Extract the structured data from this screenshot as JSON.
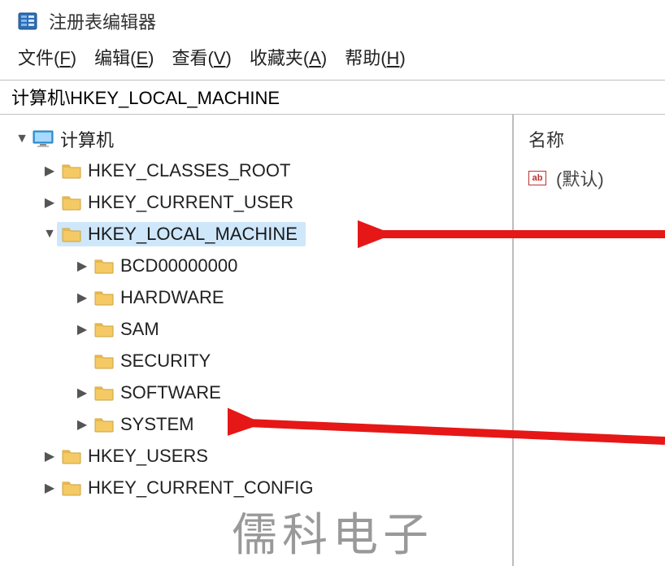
{
  "window_title": "注册表编辑器",
  "menu": {
    "file": {
      "label": "文件",
      "accel": "F"
    },
    "edit": {
      "label": "编辑",
      "accel": "E"
    },
    "view": {
      "label": "查看",
      "accel": "V"
    },
    "fav": {
      "label": "收藏夹",
      "accel": "A"
    },
    "help": {
      "label": "帮助",
      "accel": "H"
    }
  },
  "address": "计算机\\HKEY_LOCAL_MACHINE",
  "tree": {
    "root": {
      "label": "计算机",
      "expanded": true
    },
    "items": [
      {
        "label": "HKEY_CLASSES_ROOT",
        "depth": 1,
        "expanded": false,
        "hasChildren": true,
        "selected": false
      },
      {
        "label": "HKEY_CURRENT_USER",
        "depth": 1,
        "expanded": false,
        "hasChildren": true,
        "selected": false
      },
      {
        "label": "HKEY_LOCAL_MACHINE",
        "depth": 1,
        "expanded": true,
        "hasChildren": true,
        "selected": true
      },
      {
        "label": "BCD00000000",
        "depth": 2,
        "expanded": false,
        "hasChildren": true,
        "selected": false
      },
      {
        "label": "HARDWARE",
        "depth": 2,
        "expanded": false,
        "hasChildren": true,
        "selected": false
      },
      {
        "label": "SAM",
        "depth": 2,
        "expanded": false,
        "hasChildren": true,
        "selected": false
      },
      {
        "label": "SECURITY",
        "depth": 2,
        "expanded": false,
        "hasChildren": false,
        "selected": false
      },
      {
        "label": "SOFTWARE",
        "depth": 2,
        "expanded": false,
        "hasChildren": true,
        "selected": false
      },
      {
        "label": "SYSTEM",
        "depth": 2,
        "expanded": false,
        "hasChildren": true,
        "selected": false
      },
      {
        "label": "HKEY_USERS",
        "depth": 1,
        "expanded": false,
        "hasChildren": true,
        "selected": false
      },
      {
        "label": "HKEY_CURRENT_CONFIG",
        "depth": 1,
        "expanded": false,
        "hasChildren": true,
        "selected": false
      }
    ]
  },
  "list": {
    "header_name": "名称",
    "default_value": "(默认)"
  },
  "watermark": "儒科电子",
  "icons": {
    "app": "regedit-icon",
    "computer": "computer-icon",
    "folder": "folder-icon",
    "string": "ab-string-icon"
  },
  "annotation": {
    "arrows": [
      {
        "points_to": "HKEY_LOCAL_MACHINE"
      },
      {
        "points_to": "SYSTEM"
      }
    ]
  }
}
